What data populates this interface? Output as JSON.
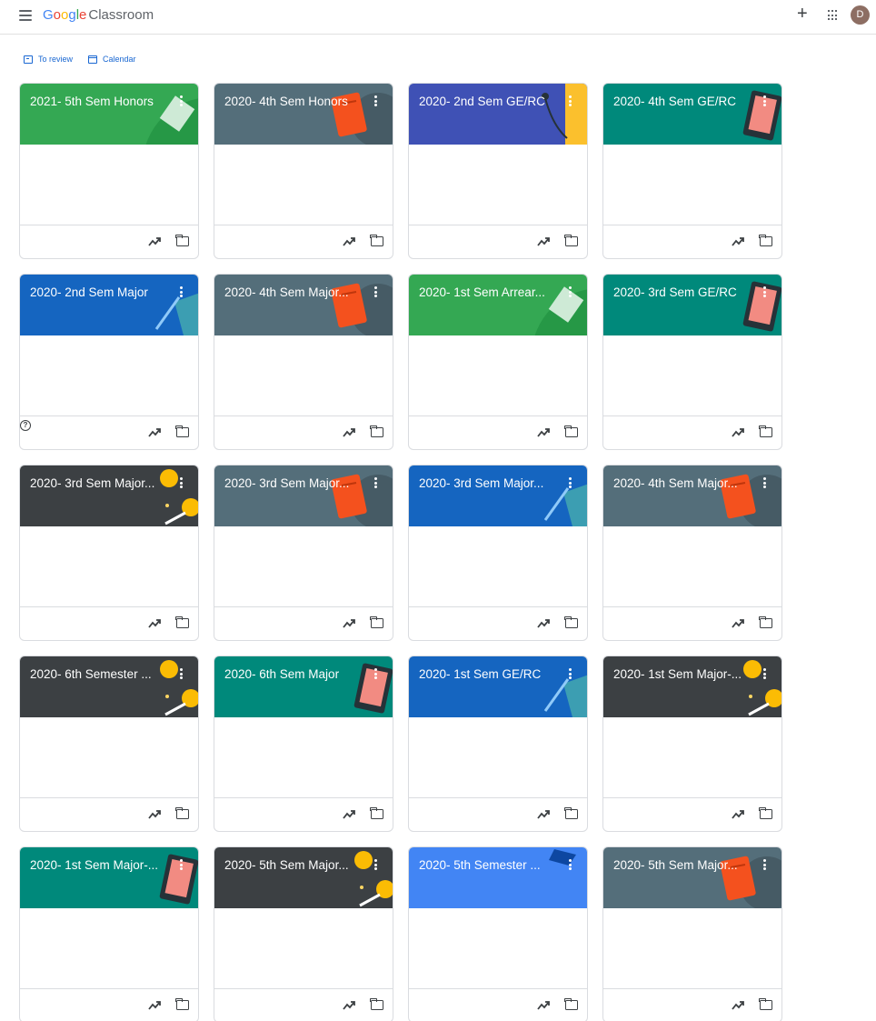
{
  "app": {
    "brand_google": "Google",
    "brand_product": "Classroom",
    "avatar_initial": "D"
  },
  "icons": {
    "menu": "hamburger-menu-icon",
    "add": "plus-icon",
    "apps": "apps-grid-icon",
    "trend": "trending-up-icon",
    "folder": "folder-icon",
    "more": "more-vert-icon",
    "help": "help-icon"
  },
  "nav": {
    "to_review": "To review",
    "calendar": "Calendar"
  },
  "theme_colors": {
    "green": "#34a853",
    "slate": "#546e7a",
    "blue": "#3f51b5",
    "teal": "#00897b",
    "dark": "#3c4043",
    "ocean": "#1565c0",
    "sky": "#4285f4"
  },
  "classes": [
    {
      "title": "2021- 5th Sem Honors",
      "theme": "green"
    },
    {
      "title": "2020- 4th Sem Honors",
      "theme": "slate"
    },
    {
      "title": "2020- 2nd Sem GE/RC",
      "theme": "blue"
    },
    {
      "title": "2020- 4th Sem GE/RC",
      "theme": "teal"
    },
    {
      "title": "2020- 2nd Sem Major",
      "theme": "ocean"
    },
    {
      "title": "2020- 4th Sem Major...",
      "theme": "slate"
    },
    {
      "title": "2020- 1st Sem Arrear...",
      "theme": "green"
    },
    {
      "title": "2020- 3rd Sem GE/RC",
      "theme": "teal"
    },
    {
      "title": "2020- 3rd Sem Major...",
      "theme": "dark"
    },
    {
      "title": "2020- 3rd Sem Major...",
      "theme": "slate"
    },
    {
      "title": "2020- 3rd Sem Major...",
      "theme": "ocean"
    },
    {
      "title": "2020- 4th Sem Major...",
      "theme": "slate"
    },
    {
      "title": "2020- 6th Semester ...",
      "theme": "dark"
    },
    {
      "title": "2020- 6th Sem Major",
      "theme": "teal"
    },
    {
      "title": "2020- 1st Sem GE/RC",
      "theme": "ocean"
    },
    {
      "title": "2020- 1st Sem Major-...",
      "theme": "dark"
    },
    {
      "title": "2020- 1st Sem Major-...",
      "theme": "teal"
    },
    {
      "title": "2020- 5th Sem Major...",
      "theme": "dark"
    },
    {
      "title": "2020- 5th Semester ...",
      "theme": "sky"
    },
    {
      "title": "2020- 5th Sem Major...",
      "theme": "slate"
    }
  ]
}
